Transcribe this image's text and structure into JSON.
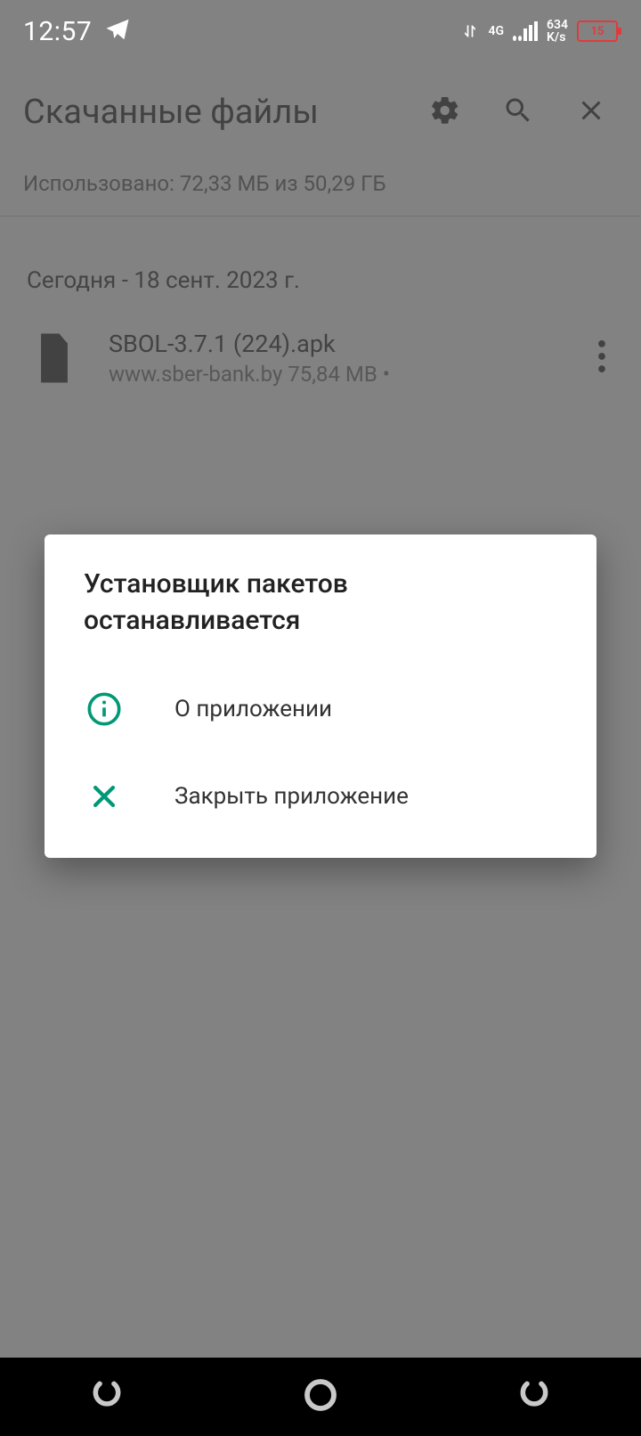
{
  "status": {
    "time": "12:57",
    "network_type": "4G",
    "net_speed_value": "634",
    "net_speed_unit": "K/s",
    "battery_percent": "15"
  },
  "header": {
    "title": "Скачанные файлы"
  },
  "usage_text": "Использовано: 72,33 МБ из 50,29 ГБ",
  "list": {
    "section_label": "Сегодня - 18 сент. 2023 г.",
    "items": [
      {
        "name": "SBOL-3.7.1 (224).apk",
        "subtitle": "www.sber-bank.by 75,84 MB •"
      }
    ]
  },
  "dialog": {
    "title": "Установщик пакетов останавливается",
    "info_label": "О приложении",
    "close_label": "Закрыть приложение"
  }
}
